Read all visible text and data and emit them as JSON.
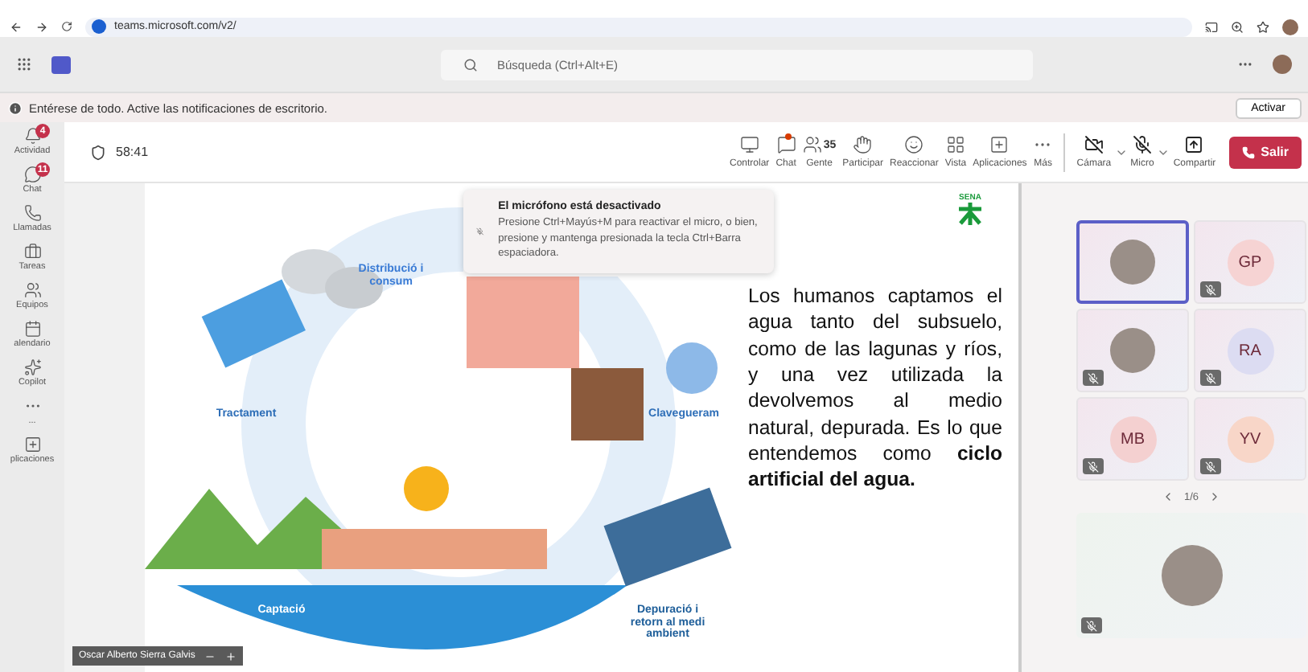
{
  "browser": {
    "url": "teams.microsoft.com/v2/"
  },
  "header": {
    "search_placeholder": "Búsqueda (Ctrl+Alt+E)"
  },
  "notice": {
    "text": "Entérese de todo. Active las notificaciones de escritorio.",
    "button": "Activar"
  },
  "rail": [
    {
      "label": "Actividad",
      "badge": "4"
    },
    {
      "label": "Chat",
      "badge": "11"
    },
    {
      "label": "Llamadas"
    },
    {
      "label": "Tareas"
    },
    {
      "label": "Equipos"
    },
    {
      "label": "alendario"
    },
    {
      "label": "Copilot"
    },
    {
      "label": "..."
    },
    {
      "label": "plicaciones"
    }
  ],
  "meeting": {
    "timer": "58:41",
    "tools": [
      {
        "label": "Controlar",
        "dot": false
      },
      {
        "label": "Chat",
        "dot": true
      },
      {
        "label": "Gente",
        "count": "35",
        "dot": false
      },
      {
        "label": "Participar",
        "dot": false
      },
      {
        "label": "Reaccionar",
        "dot": false
      },
      {
        "label": "Vista",
        "dot": false
      },
      {
        "label": "Aplicaciones",
        "dot": false
      },
      {
        "label": "Más",
        "dot": false
      }
    ],
    "devices": [
      {
        "label": "Cámara",
        "kind": "dropdown"
      },
      {
        "label": "Micro",
        "kind": "dropdown"
      },
      {
        "label": "Compartir",
        "kind": "plain"
      }
    ],
    "leave": "Salir"
  },
  "slide": {
    "labels": [
      "Distribució i consum",
      "Tractament",
      "Clavegueram",
      "Captació",
      "Depuració i retorn al medi ambient"
    ],
    "logo": "SENA",
    "paragraph": "Los humanos captamos el agua tanto del subsuelo, como de las lagunas y ríos, y una vez utilizada la devolvemos al medio natural, depurada. Es lo que entendemos como **ciclo artificial del agua.**"
  },
  "toast": {
    "title": "El micrófono está desactivado",
    "body": "Presione Ctrl+Mayús+M para reactivar el micro, o bien, presione y mantenga presionada la tecla Ctrl+Barra espaciadora."
  },
  "presenter": "Oscar Alberto Sierra Galvis",
  "gallery": {
    "tiles": [
      {
        "kind": "photo",
        "muted": false,
        "selected": true
      },
      {
        "kind": "initials",
        "initials": "GP",
        "color": "#f6d3d3",
        "muted": true,
        "selected": false
      },
      {
        "kind": "photo",
        "muted": true,
        "selected": false
      },
      {
        "kind": "initials",
        "initials": "RA",
        "color": "#dcdcf2",
        "muted": true,
        "selected": false
      },
      {
        "kind": "initials",
        "initials": "MB",
        "color": "#f4d0d0",
        "muted": true,
        "selected": false
      },
      {
        "kind": "initials",
        "initials": "YV",
        "color": "#f8d6c8",
        "muted": true,
        "selected": false
      }
    ],
    "pager": "1/6",
    "featured": {
      "kind": "photo",
      "muted": true
    }
  }
}
